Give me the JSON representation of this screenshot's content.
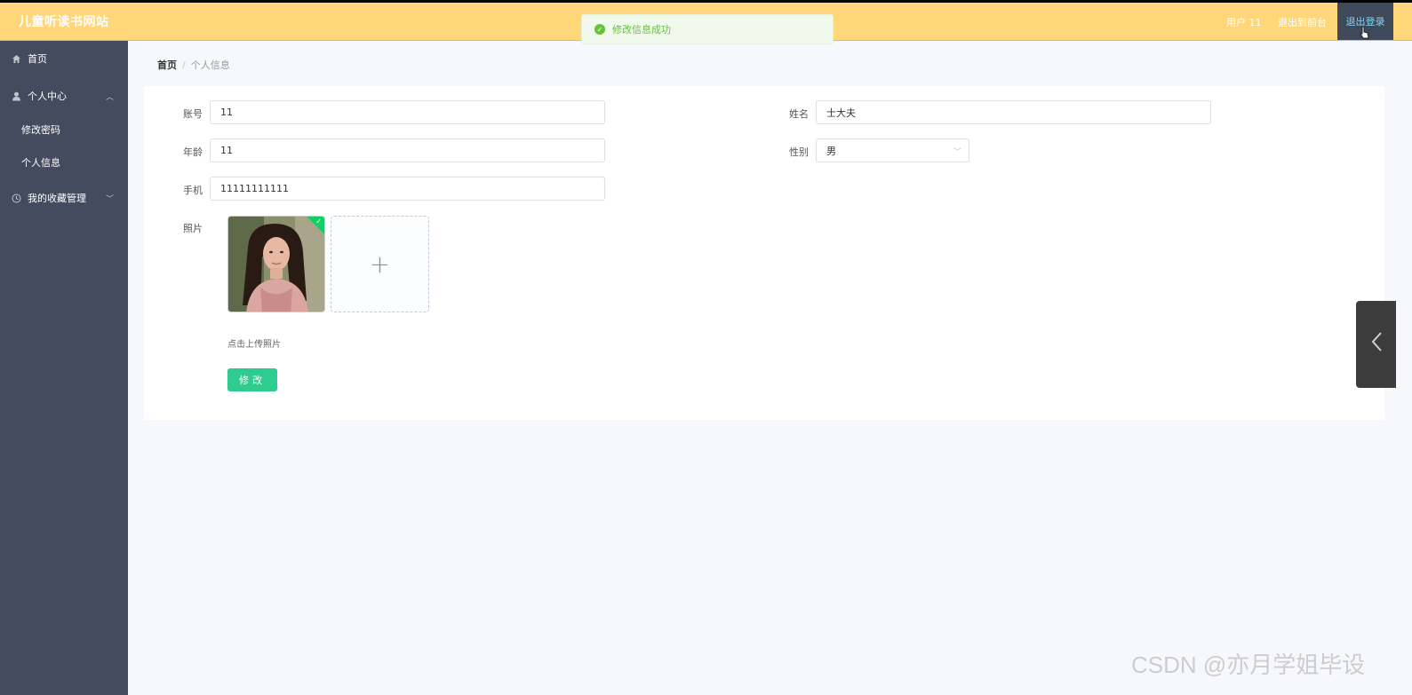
{
  "header": {
    "brand": "儿童听读书网站",
    "user_label": "用户 11",
    "exit_front": "退出到前台",
    "logout": "退出登录"
  },
  "toast": {
    "text": "修改信息成功",
    "icon": "check-circle-icon",
    "color": "#67c23a"
  },
  "sidebar": {
    "items": [
      {
        "label": "首页",
        "icon": "home-icon"
      },
      {
        "label": "个人中心",
        "icon": "user-icon",
        "expanded": true
      },
      {
        "label": "修改密码"
      },
      {
        "label": "个人信息"
      },
      {
        "label": "我的收藏管理",
        "icon": "clock-icon",
        "expanded": false
      }
    ]
  },
  "breadcrumb": {
    "home": "首页",
    "separator": "/",
    "current": "个人信息"
  },
  "form": {
    "account_label": "账号",
    "account_value": "11",
    "name_label": "姓名",
    "name_value": "士大夫",
    "age_label": "年龄",
    "age_value": "11",
    "gender_label": "性别",
    "gender_value": "男",
    "phone_label": "手机",
    "phone_value": "11111111111",
    "photo_label": "照片",
    "upload_plus": "+",
    "upload_tip": "点击上传照片",
    "submit_label": "修改"
  },
  "watermark": "CSDN @亦月学姐毕设",
  "colors": {
    "header": "#ffd77a",
    "sidebar": "#454b5e",
    "primary_button": "#2ecc8e",
    "logout_bg": "#3e4a5a"
  }
}
